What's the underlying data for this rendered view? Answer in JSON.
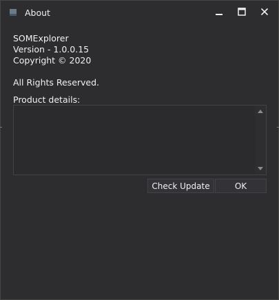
{
  "window": {
    "title": "About",
    "controls": {
      "minimize": "minimize",
      "maximize": "maximize",
      "close": "close"
    }
  },
  "info": {
    "app_name": "SOMExplorer",
    "version": "Version - 1.0.0.15",
    "copyright": "Copyright ©  2020",
    "rights": "All Rights Reserved.",
    "details_label": "Product details:"
  },
  "details": {
    "value": ""
  },
  "buttons": {
    "check_update": "Check Update",
    "ok": "OK"
  },
  "icons": {
    "app": "app-icon",
    "minimize": "minimize-icon",
    "maximize": "maximize-icon",
    "close": "close-icon",
    "scroll_up": "scroll-up-arrow-icon",
    "scroll_down": "scroll-down-arrow-icon"
  },
  "colors": {
    "background": "#2d2d30",
    "text": "#f1f1f1",
    "border": "#434346",
    "button": "#333337"
  }
}
